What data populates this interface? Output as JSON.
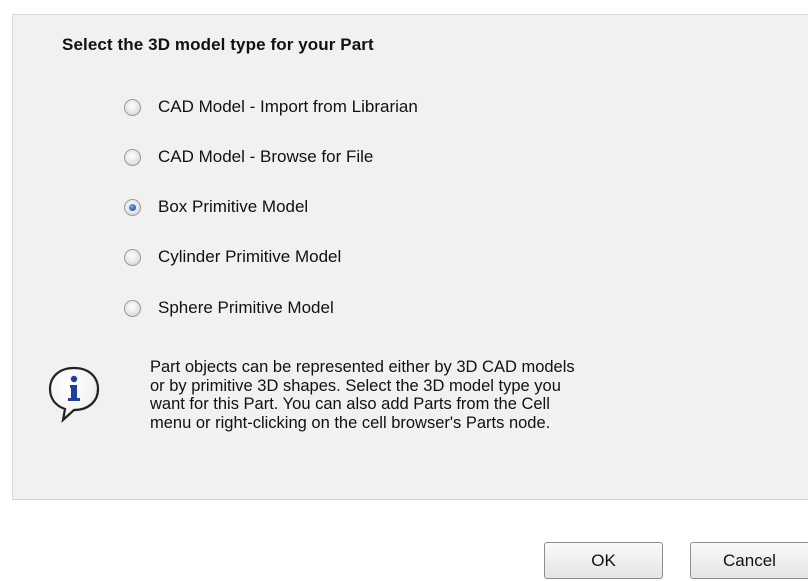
{
  "dialog": {
    "heading": "Select the 3D model type for your Part",
    "options": [
      {
        "label": "CAD Model - Import from Librarian",
        "checked": false
      },
      {
        "label": "CAD Model - Browse for File",
        "checked": false
      },
      {
        "label": "Box Primitive Model",
        "checked": true
      },
      {
        "label": "Cylinder Primitive Model",
        "checked": false
      },
      {
        "label": "Sphere Primitive Model",
        "checked": false
      }
    ],
    "info_icon": "info-icon",
    "info_lines": [
      "Part objects can be represented either by 3D CAD models",
      "or by primitive 3D shapes.  Select the 3D model type you",
      "want for this Part.  You can also add Parts from the Cell",
      "menu or right-clicking on the cell browser's Parts node."
    ]
  },
  "buttons": {
    "ok_label": "OK",
    "cancel_label": "Cancel"
  },
  "colors": {
    "panel_bg": "#f1f1f1",
    "radio_selected": "#2c63b8"
  }
}
